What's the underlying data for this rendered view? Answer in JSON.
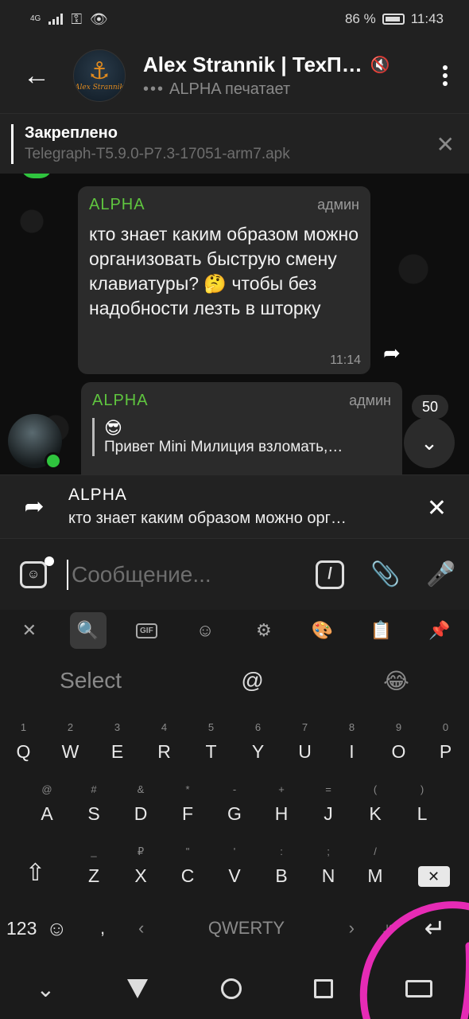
{
  "status_bar": {
    "network": "4G",
    "battery_percent": "86 %",
    "time": "11:43"
  },
  "header": {
    "back_icon": "arrow-left-icon",
    "avatar_label": "Alex Strannik",
    "title": "Alex Strannik | ТехП…",
    "subtitle_dots": "•••",
    "subtitle": "ALPHA печатает"
  },
  "pinned": {
    "title": "Закреплено",
    "text": "Telegraph-T5.9.0-P7.3-17051-arm7.apk"
  },
  "messages": [
    {
      "sender": "ALPHA",
      "role": "админ",
      "text": "кто знает каким образом можно организовать быструю смену клавиатуры? 🤔 чтобы без надобности лезть в шторку",
      "time": "11:14"
    },
    {
      "sender": "ALPHA",
      "role": "админ",
      "reply_emoji": "😎",
      "reply_text": "Привет Mini Милиция взломать,…"
    }
  ],
  "scroll": {
    "unread_count": "50"
  },
  "reply_bar": {
    "name": "ALPHA",
    "text": "кто знает каким образом можно орг…"
  },
  "input": {
    "placeholder": "Сообщение...",
    "command_symbol": "/"
  },
  "keyboard": {
    "toolbar": [
      "close-icon",
      "search-icon",
      "gif-icon",
      "sticker-icon",
      "settings-icon",
      "palette-icon",
      "clipboard-icon",
      "pin-icon"
    ],
    "gif_label": "GIF",
    "suggestions": [
      "Select",
      "@",
      "😂"
    ],
    "row1": [
      {
        "alt": "1",
        "key": "Q"
      },
      {
        "alt": "2",
        "key": "W"
      },
      {
        "alt": "3",
        "key": "E"
      },
      {
        "alt": "4",
        "key": "R"
      },
      {
        "alt": "5",
        "key": "T"
      },
      {
        "alt": "6",
        "key": "Y"
      },
      {
        "alt": "7",
        "key": "U"
      },
      {
        "alt": "8",
        "key": "I"
      },
      {
        "alt": "9",
        "key": "O"
      },
      {
        "alt": "0",
        "key": "P"
      }
    ],
    "row2": [
      {
        "alt": "@",
        "key": "A"
      },
      {
        "alt": "#",
        "key": "S"
      },
      {
        "alt": "&",
        "key": "D"
      },
      {
        "alt": "*",
        "key": "F"
      },
      {
        "alt": "-",
        "key": "G"
      },
      {
        "alt": "+",
        "key": "H"
      },
      {
        "alt": "=",
        "key": "J"
      },
      {
        "alt": "(",
        "key": "K"
      },
      {
        "alt": ")",
        "key": "L"
      }
    ],
    "row3": [
      {
        "alt": "_",
        "key": "Z"
      },
      {
        "alt": "₽",
        "key": "X"
      },
      {
        "alt": "\"",
        "key": "C"
      },
      {
        "alt": "'",
        "key": "V"
      },
      {
        "alt": ":",
        "key": "B"
      },
      {
        "alt": ";",
        "key": "N"
      },
      {
        "alt": "/",
        "key": "M"
      }
    ],
    "mode_label": "123",
    "comma": ",",
    "space_label": "QWERTY",
    "punct": ",!?"
  }
}
